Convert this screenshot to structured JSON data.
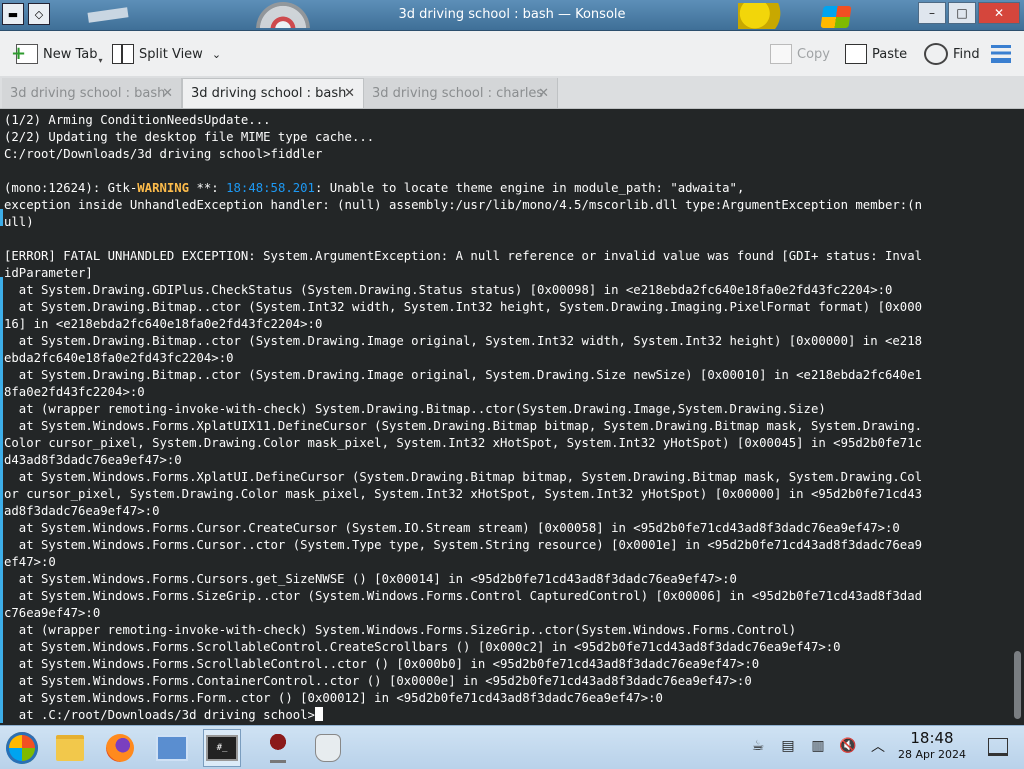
{
  "window": {
    "title": "3d driving school : bash — Konsole",
    "controls": [
      "–",
      "□",
      "✕"
    ]
  },
  "toolbar": {
    "new_tab": "New Tab",
    "split_view": "Split View",
    "copy": "Copy",
    "paste": "Paste",
    "find": "Find"
  },
  "tabs": [
    {
      "label": "3d driving school : bash",
      "active": false
    },
    {
      "label": "3d driving school : bash",
      "active": true
    },
    {
      "label": "3d driving school : charles",
      "active": false
    }
  ],
  "terminal": {
    "lines": [
      "(1/2) Arming ConditionNeedsUpdate...",
      "(2/2) Updating the desktop file MIME type cache...",
      "C:/root/Downloads/3d driving school>fiddler",
      "",
      "(mono:12624): Gtk-",
      "exception inside UnhandledException handler: (null) assembly:/usr/lib/mono/4.5/mscorlib.dll type:ArgumentException member:(n",
      "ull)",
      "",
      "[ERROR] FATAL UNHANDLED EXCEPTION: System.ArgumentException: A null reference or invalid value was found [GDI+ status: Inval",
      "idParameter]",
      "  at System.Drawing.GDIPlus.CheckStatus (System.Drawing.Status status) [0x00098] in <e218ebda2fc640e18fa0e2fd43fc2204>:0",
      "  at System.Drawing.Bitmap..ctor (System.Int32 width, System.Int32 height, System.Drawing.Imaging.PixelFormat format) [0x000",
      "16] in <e218ebda2fc640e18fa0e2fd43fc2204>:0",
      "  at System.Drawing.Bitmap..ctor (System.Drawing.Image original, System.Int32 width, System.Int32 height) [0x00000] in <e218",
      "ebda2fc640e18fa0e2fd43fc2204>:0",
      "  at System.Drawing.Bitmap..ctor (System.Drawing.Image original, System.Drawing.Size newSize) [0x00010] in <e218ebda2fc640e1",
      "8fa0e2fd43fc2204>:0",
      "  at (wrapper remoting-invoke-with-check) System.Drawing.Bitmap..ctor(System.Drawing.Image,System.Drawing.Size)",
      "  at System.Windows.Forms.XplatUIX11.DefineCursor (System.Drawing.Bitmap bitmap, System.Drawing.Bitmap mask, System.Drawing.",
      "Color cursor_pixel, System.Drawing.Color mask_pixel, System.Int32 xHotSpot, System.Int32 yHotSpot) [0x00045] in <95d2b0fe71c",
      "d43ad8f3dadc76ea9ef47>:0",
      "  at System.Windows.Forms.XplatUI.DefineCursor (System.Drawing.Bitmap bitmap, System.Drawing.Bitmap mask, System.Drawing.Col",
      "or cursor_pixel, System.Drawing.Color mask_pixel, System.Int32 xHotSpot, System.Int32 yHotSpot) [0x00000] in <95d2b0fe71cd43",
      "ad8f3dadc76ea9ef47>:0",
      "  at System.Windows.Forms.Cursor.CreateCursor (System.IO.Stream stream) [0x00058] in <95d2b0fe71cd43ad8f3dadc76ea9ef47>:0",
      "  at System.Windows.Forms.Cursor..ctor (System.Type type, System.String resource) [0x0001e] in <95d2b0fe71cd43ad8f3dadc76ea9",
      "ef47>:0",
      "  at System.Windows.Forms.Cursors.get_SizeNWSE () [0x00014] in <95d2b0fe71cd43ad8f3dadc76ea9ef47>:0",
      "  at System.Windows.Forms.SizeGrip..ctor (System.Windows.Forms.Control CapturedControl) [0x00006] in <95d2b0fe71cd43ad8f3dad",
      "c76ea9ef47>:0",
      "  at (wrapper remoting-invoke-with-check) System.Windows.Forms.SizeGrip..ctor(System.Windows.Forms.Control)",
      "  at System.Windows.Forms.ScrollableControl.CreateScrollbars () [0x000c2] in <95d2b0fe71cd43ad8f3dadc76ea9ef47>:0",
      "  at System.Windows.Forms.ScrollableControl..ctor () [0x000b0] in <95d2b0fe71cd43ad8f3dadc76ea9ef47>:0",
      "  at System.Windows.Forms.ContainerControl..ctor () [0x0000e] in <95d2b0fe71cd43ad8f3dadc76ea9ef47>:0",
      "  at System.Windows.Forms.Form..ctor () [0x00012] in <95d2b0fe71cd43ad8f3dadc76ea9ef47>:0",
      "  at .C:/root/Downloads/3d driving school>"
    ],
    "warn_parts": {
      "warning_word": "WARNING",
      "stars": " **: ",
      "time": "18:48:58.201",
      "message": ": Unable to locate theme engine in module_path: \"adwaita\","
    },
    "colors": {
      "background": "#232627",
      "foreground": "#fcfcfc",
      "warning": "#fdbc4b",
      "time": "#1d99f3"
    }
  },
  "taskbar": {
    "items": [
      "start-button",
      "file-manager",
      "firefox",
      "system-monitor",
      "konsole",
      "wine",
      "jug-app"
    ],
    "clock_time": "18:48",
    "clock_date": "28 Apr 2024"
  }
}
